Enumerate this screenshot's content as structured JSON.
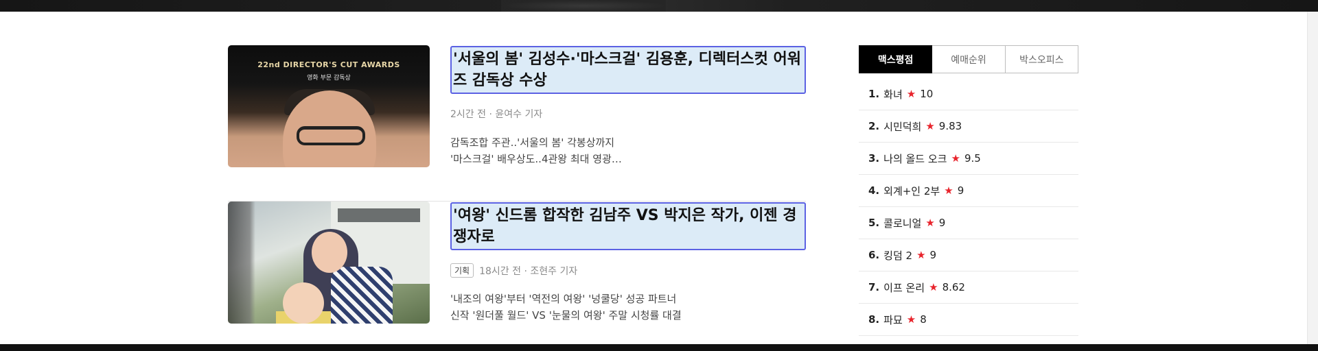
{
  "news": [
    {
      "title": "'서울의 봄' 김성수·'마스크걸' 김용훈, 디렉터스컷 어워즈 감독상 수상",
      "tag": "",
      "meta": "2시간 전 · 윤여수 기자",
      "summary": [
        "감독조합 주관..'서울의 봄' 각봉상까지",
        "'마스크걸' 배우상도..4관왕 최대 영광…"
      ],
      "thumb_text": "22nd DIRECTOR'S CUT AWARDS",
      "thumb_sub": "영화 부문 감독상"
    },
    {
      "title": "'여왕' 신드롬 합작한 김남주 VS 박지은 작가, 이젠 경쟁자로",
      "tag": "기획",
      "meta": "18시간 전 · 조현주 기자",
      "summary": [
        "'내조의 여왕'부터 '역전의 여왕' '넝쿨당' 성공 파트너",
        "신작 '원더풀 월드' VS '눈물의 여왕' 주말 시청률 대결"
      ]
    }
  ],
  "ranking": {
    "tabs": [
      {
        "label": "맥스평점",
        "active": true
      },
      {
        "label": "예매순위",
        "active": false
      },
      {
        "label": "박스오피스",
        "active": false
      }
    ],
    "items": [
      {
        "rank": "1.",
        "title": "화녀",
        "score": "10"
      },
      {
        "rank": "2.",
        "title": "시민덕희",
        "score": "9.83"
      },
      {
        "rank": "3.",
        "title": "나의 올드 오크",
        "score": "9.5"
      },
      {
        "rank": "4.",
        "title": "외계+인 2부",
        "score": "9"
      },
      {
        "rank": "5.",
        "title": "콜로니얼",
        "score": "9"
      },
      {
        "rank": "6.",
        "title": "킹덤 2",
        "score": "9"
      },
      {
        "rank": "7.",
        "title": "이프 온리",
        "score": "8.62"
      },
      {
        "rank": "8.",
        "title": "파묘",
        "score": "8"
      }
    ],
    "star_icon": "star-icon",
    "star_color": "#e8242c"
  },
  "colors": {
    "title_highlight_bg": "#dcebf7",
    "title_highlight_border": "#5b61e3",
    "active_tab_bg": "#000000"
  }
}
